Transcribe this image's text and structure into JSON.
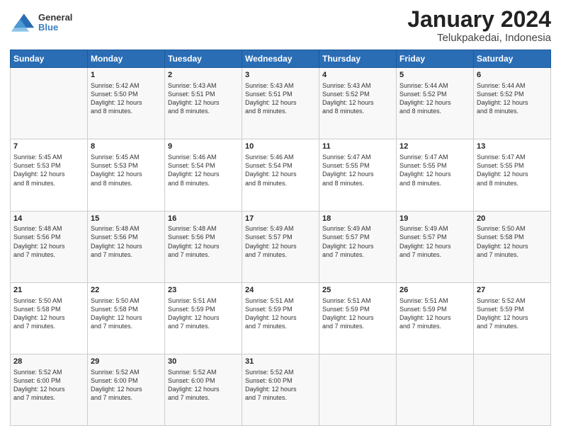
{
  "header": {
    "logo_line1": "General",
    "logo_line2": "Blue",
    "title": "January 2024",
    "subtitle": "Telukpakedai, Indonesia"
  },
  "days_of_week": [
    "Sunday",
    "Monday",
    "Tuesday",
    "Wednesday",
    "Thursday",
    "Friday",
    "Saturday"
  ],
  "weeks": [
    [
      {
        "day": "",
        "info": ""
      },
      {
        "day": "1",
        "info": "Sunrise: 5:42 AM\nSunset: 5:50 PM\nDaylight: 12 hours\nand 8 minutes."
      },
      {
        "day": "2",
        "info": "Sunrise: 5:43 AM\nSunset: 5:51 PM\nDaylight: 12 hours\nand 8 minutes."
      },
      {
        "day": "3",
        "info": "Sunrise: 5:43 AM\nSunset: 5:51 PM\nDaylight: 12 hours\nand 8 minutes."
      },
      {
        "day": "4",
        "info": "Sunrise: 5:43 AM\nSunset: 5:52 PM\nDaylight: 12 hours\nand 8 minutes."
      },
      {
        "day": "5",
        "info": "Sunrise: 5:44 AM\nSunset: 5:52 PM\nDaylight: 12 hours\nand 8 minutes."
      },
      {
        "day": "6",
        "info": "Sunrise: 5:44 AM\nSunset: 5:52 PM\nDaylight: 12 hours\nand 8 minutes."
      }
    ],
    [
      {
        "day": "7",
        "info": "Sunrise: 5:45 AM\nSunset: 5:53 PM\nDaylight: 12 hours\nand 8 minutes."
      },
      {
        "day": "8",
        "info": "Sunrise: 5:45 AM\nSunset: 5:53 PM\nDaylight: 12 hours\nand 8 minutes."
      },
      {
        "day": "9",
        "info": "Sunrise: 5:46 AM\nSunset: 5:54 PM\nDaylight: 12 hours\nand 8 minutes."
      },
      {
        "day": "10",
        "info": "Sunrise: 5:46 AM\nSunset: 5:54 PM\nDaylight: 12 hours\nand 8 minutes."
      },
      {
        "day": "11",
        "info": "Sunrise: 5:47 AM\nSunset: 5:55 PM\nDaylight: 12 hours\nand 8 minutes."
      },
      {
        "day": "12",
        "info": "Sunrise: 5:47 AM\nSunset: 5:55 PM\nDaylight: 12 hours\nand 8 minutes."
      },
      {
        "day": "13",
        "info": "Sunrise: 5:47 AM\nSunset: 5:55 PM\nDaylight: 12 hours\nand 8 minutes."
      }
    ],
    [
      {
        "day": "14",
        "info": "Sunrise: 5:48 AM\nSunset: 5:56 PM\nDaylight: 12 hours\nand 7 minutes."
      },
      {
        "day": "15",
        "info": "Sunrise: 5:48 AM\nSunset: 5:56 PM\nDaylight: 12 hours\nand 7 minutes."
      },
      {
        "day": "16",
        "info": "Sunrise: 5:48 AM\nSunset: 5:56 PM\nDaylight: 12 hours\nand 7 minutes."
      },
      {
        "day": "17",
        "info": "Sunrise: 5:49 AM\nSunset: 5:57 PM\nDaylight: 12 hours\nand 7 minutes."
      },
      {
        "day": "18",
        "info": "Sunrise: 5:49 AM\nSunset: 5:57 PM\nDaylight: 12 hours\nand 7 minutes."
      },
      {
        "day": "19",
        "info": "Sunrise: 5:49 AM\nSunset: 5:57 PM\nDaylight: 12 hours\nand 7 minutes."
      },
      {
        "day": "20",
        "info": "Sunrise: 5:50 AM\nSunset: 5:58 PM\nDaylight: 12 hours\nand 7 minutes."
      }
    ],
    [
      {
        "day": "21",
        "info": "Sunrise: 5:50 AM\nSunset: 5:58 PM\nDaylight: 12 hours\nand 7 minutes."
      },
      {
        "day": "22",
        "info": "Sunrise: 5:50 AM\nSunset: 5:58 PM\nDaylight: 12 hours\nand 7 minutes."
      },
      {
        "day": "23",
        "info": "Sunrise: 5:51 AM\nSunset: 5:59 PM\nDaylight: 12 hours\nand 7 minutes."
      },
      {
        "day": "24",
        "info": "Sunrise: 5:51 AM\nSunset: 5:59 PM\nDaylight: 12 hours\nand 7 minutes."
      },
      {
        "day": "25",
        "info": "Sunrise: 5:51 AM\nSunset: 5:59 PM\nDaylight: 12 hours\nand 7 minutes."
      },
      {
        "day": "26",
        "info": "Sunrise: 5:51 AM\nSunset: 5:59 PM\nDaylight: 12 hours\nand 7 minutes."
      },
      {
        "day": "27",
        "info": "Sunrise: 5:52 AM\nSunset: 5:59 PM\nDaylight: 12 hours\nand 7 minutes."
      }
    ],
    [
      {
        "day": "28",
        "info": "Sunrise: 5:52 AM\nSunset: 6:00 PM\nDaylight: 12 hours\nand 7 minutes."
      },
      {
        "day": "29",
        "info": "Sunrise: 5:52 AM\nSunset: 6:00 PM\nDaylight: 12 hours\nand 7 minutes."
      },
      {
        "day": "30",
        "info": "Sunrise: 5:52 AM\nSunset: 6:00 PM\nDaylight: 12 hours\nand 7 minutes."
      },
      {
        "day": "31",
        "info": "Sunrise: 5:52 AM\nSunset: 6:00 PM\nDaylight: 12 hours\nand 7 minutes."
      },
      {
        "day": "",
        "info": ""
      },
      {
        "day": "",
        "info": ""
      },
      {
        "day": "",
        "info": ""
      }
    ]
  ]
}
